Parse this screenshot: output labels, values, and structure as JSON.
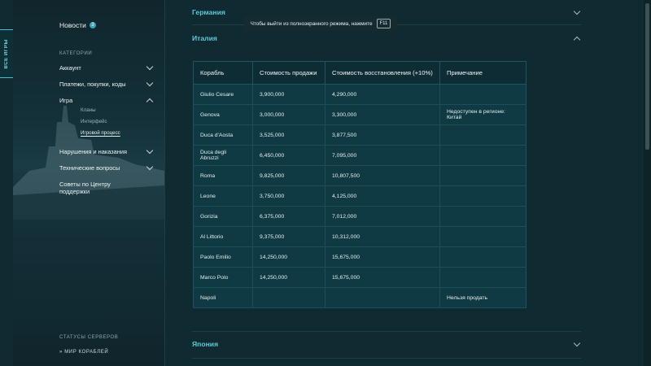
{
  "left_tab": {
    "label": "ВСЕ ИГРЫ"
  },
  "sidebar": {
    "news": {
      "label": "Новости",
      "badge": "3"
    },
    "categories_header": "КАТЕГОРИИ",
    "items": [
      {
        "label": "Аккаунт",
        "expanded": false
      },
      {
        "label": "Платежи, покупки, коды",
        "expanded": false
      },
      {
        "label": "Игра",
        "expanded": true,
        "children": [
          "Кланы",
          "Интерфейс",
          "Игровой процесс"
        ]
      },
      {
        "label": "Нарушения и наказания",
        "expanded": false
      },
      {
        "label": "Технические вопросы",
        "expanded": false
      },
      {
        "label": "Советы по Центру поддержки",
        "expanded": false
      }
    ],
    "servers_header": "СТАТУСЫ СЕРВЕРОВ",
    "servers_item": "»  МИР КОРАБЛЕЙ"
  },
  "toast": {
    "text": "Чтобы выйти из полноэкранного режима, нажмите",
    "key": "F11"
  },
  "sections": [
    {
      "title": "Германия",
      "expanded": false
    },
    {
      "title": "Италия",
      "expanded": true
    },
    {
      "title": "Япония",
      "expanded": false
    }
  ],
  "table": {
    "headers": [
      "Корабль",
      "Стоимость продажи",
      "Стоимость восстановления (+10%)",
      "Примечание"
    ],
    "rows": [
      [
        "Giulio Cesare",
        "3,900,000",
        "4,290,000",
        ""
      ],
      [
        "Genova",
        "3,000,000",
        "3,300,000",
        "Недоступен в регионе: Китай"
      ],
      [
        "Duca d'Aosta",
        "3,525,000",
        "3,877,500",
        ""
      ],
      [
        "Duca degli Abruzzi",
        "6,450,000",
        "7,095,000",
        ""
      ],
      [
        "Roma",
        "9,825,000",
        "10,807,500",
        ""
      ],
      [
        "Leone",
        "3,750,000",
        "4,125,000",
        ""
      ],
      [
        "Gorizia",
        "6,375,000",
        "7,012,000",
        ""
      ],
      [
        "Al Littorio",
        "9,375,000",
        "10,312,000",
        ""
      ],
      [
        "Paolo Emilio",
        "14,250,000",
        "15,675,000",
        ""
      ],
      [
        "Marco Polo",
        "14,250,000",
        "15,675,000",
        ""
      ],
      [
        "Napoli",
        "",
        "",
        "Нельзя продать"
      ]
    ]
  },
  "colors": {
    "accent": "#5fc9d6",
    "background": "#0f2a31",
    "table_bg": "#0f3a43"
  }
}
